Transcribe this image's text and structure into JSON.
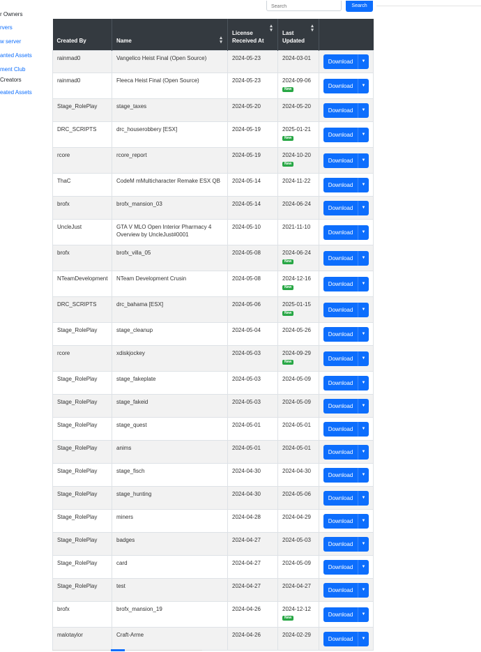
{
  "sidebar": {
    "items": [
      {
        "label": "r Owners",
        "style": "dark"
      },
      {
        "label": "rvers",
        "style": "link"
      },
      {
        "label": "w server",
        "style": "link"
      },
      {
        "label": "anted Assets",
        "style": "link"
      },
      {
        "label": "ment Club",
        "style": "link"
      },
      {
        "label": "Creators",
        "style": "dark"
      },
      {
        "label": "eated Assets",
        "style": "link"
      }
    ]
  },
  "search": {
    "placeholder": "Search",
    "button_label": "Search"
  },
  "table": {
    "headers": {
      "created_by": "Created By",
      "name": "Name",
      "license_received_at": "License Received At",
      "last_updated": "Last Updated"
    },
    "download_label": "Download",
    "new_badge": "New",
    "rows": [
      {
        "created_by": "rainmad0",
        "name": "Vangelico Heist Final (Open Source)",
        "license": "2024-05-23",
        "updated": "2024-03-01",
        "new": false
      },
      {
        "created_by": "rainmad0",
        "name": "Fleeca Heist Final (Open Source)",
        "license": "2024-05-23",
        "updated": "2024-09-06",
        "new": true
      },
      {
        "created_by": "Stage_RolePlay",
        "name": "stage_taxes",
        "license": "2024-05-20",
        "updated": "2024-05-20",
        "new": false
      },
      {
        "created_by": "DRC_SCRIPTS",
        "name": "drc_houserobbery [ESX]",
        "license": "2024-05-19",
        "updated": "2025-01-21",
        "new": true
      },
      {
        "created_by": "rcore",
        "name": "rcore_report",
        "license": "2024-05-19",
        "updated": "2024-10-20",
        "new": true
      },
      {
        "created_by": "ThaC",
        "name": "CodeM mMulticharacter Remake ESX QB",
        "license": "2024-05-14",
        "updated": "2024-11-22",
        "new": false
      },
      {
        "created_by": "brofx",
        "name": "brofx_mansion_03",
        "license": "2024-05-14",
        "updated": "2024-06-24",
        "new": false
      },
      {
        "created_by": "UncleJust",
        "name": "GTA V MLO Open Interior Pharmacy 4 Overview by UncleJust#0001",
        "license": "2024-05-10",
        "updated": "2021-11-10",
        "new": false
      },
      {
        "created_by": "brofx",
        "name": "brofx_villa_05",
        "license": "2024-05-08",
        "updated": "2024-06-24",
        "new": true
      },
      {
        "created_by": "NTeamDevelopment",
        "name": "NTeam Development Crusin",
        "license": "2024-05-08",
        "updated": "2024-12-16",
        "new": true
      },
      {
        "created_by": "DRC_SCRIPTS",
        "name": "drc_bahama [ESX]",
        "license": "2024-05-06",
        "updated": "2025-01-15",
        "new": true
      },
      {
        "created_by": "Stage_RolePlay",
        "name": "stage_cleanup",
        "license": "2024-05-04",
        "updated": "2024-05-26",
        "new": false
      },
      {
        "created_by": "rcore",
        "name": "xdiskjockey",
        "license": "2024-05-03",
        "updated": "2024-09-29",
        "new": true
      },
      {
        "created_by": "Stage_RolePlay",
        "name": "stage_fakeplate",
        "license": "2024-05-03",
        "updated": "2024-05-09",
        "new": false
      },
      {
        "created_by": "Stage_RolePlay",
        "name": "stage_fakeid",
        "license": "2024-05-03",
        "updated": "2024-05-09",
        "new": false
      },
      {
        "created_by": "Stage_RolePlay",
        "name": "stage_quest",
        "license": "2024-05-01",
        "updated": "2024-05-01",
        "new": false
      },
      {
        "created_by": "Stage_RolePlay",
        "name": "anims",
        "license": "2024-05-01",
        "updated": "2024-05-01",
        "new": false
      },
      {
        "created_by": "Stage_RolePlay",
        "name": "stage_fisch",
        "license": "2024-04-30",
        "updated": "2024-04-30",
        "new": false
      },
      {
        "created_by": "Stage_RolePlay",
        "name": "stage_hunting",
        "license": "2024-04-30",
        "updated": "2024-05-06",
        "new": false
      },
      {
        "created_by": "Stage_RolePlay",
        "name": "miners",
        "license": "2024-04-28",
        "updated": "2024-04-29",
        "new": false
      },
      {
        "created_by": "Stage_RolePlay",
        "name": "badges",
        "license": "2024-04-27",
        "updated": "2024-05-03",
        "new": false
      },
      {
        "created_by": "Stage_RolePlay",
        "name": "card",
        "license": "2024-04-27",
        "updated": "2024-05-09",
        "new": false
      },
      {
        "created_by": "Stage_RolePlay",
        "name": "test",
        "license": "2024-04-27",
        "updated": "2024-04-27",
        "new": false
      },
      {
        "created_by": "brofx",
        "name": "brofx_mansion_19",
        "license": "2024-04-26",
        "updated": "2024-12-12",
        "new": true
      },
      {
        "created_by": "malotaylor",
        "name": "Craft-Arme",
        "license": "2024-04-26",
        "updated": "2024-02-29",
        "new": false
      }
    ]
  },
  "colors": {
    "header_bg": "#343a40",
    "primary": "#0d6efd",
    "badge_new": "#28a745",
    "row_stripe": "#f2f2f2"
  },
  "icons": {
    "sort": "sort-icon",
    "dropdown": "caret-down-icon"
  }
}
